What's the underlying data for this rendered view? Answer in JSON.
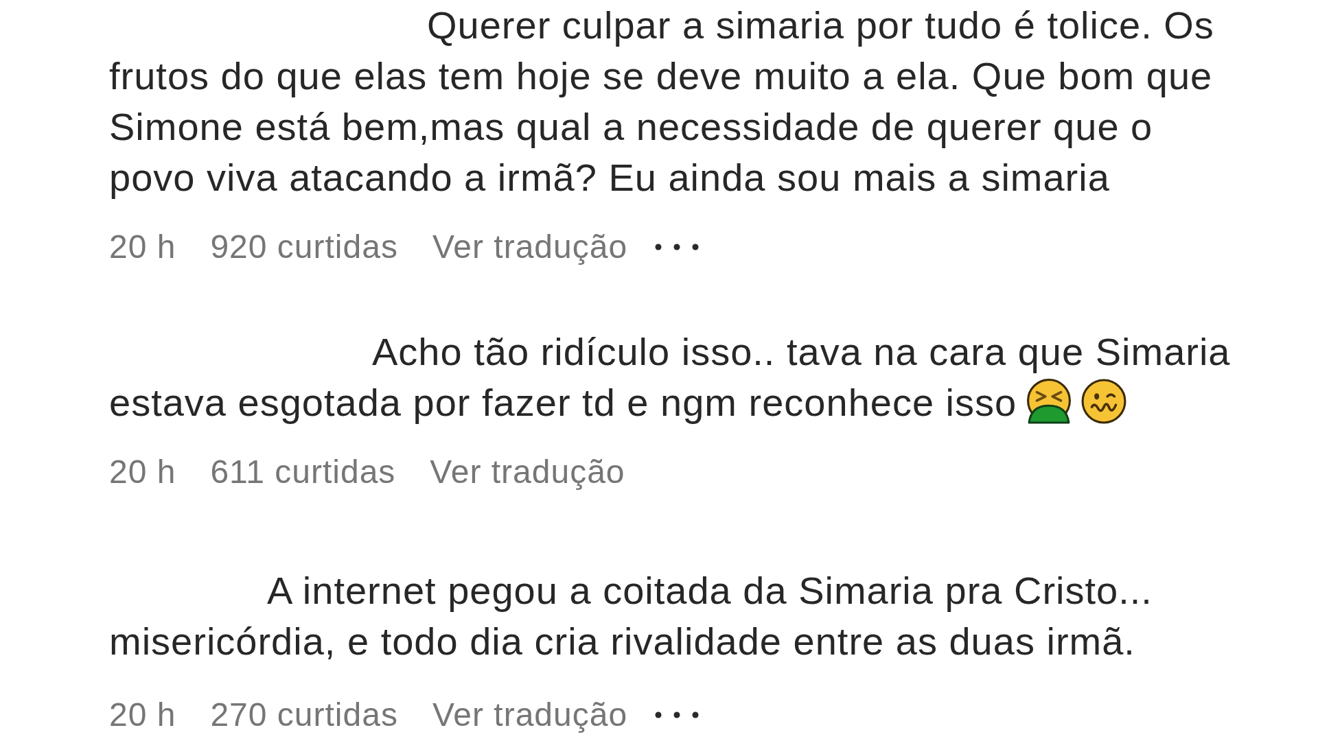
{
  "comments": [
    {
      "text": "Querer culpar a simaria por tudo é tolice. Os frutos do que elas tem hoje se deve muito a ela. Que bom que Simone está bem,mas qual a necessidade de querer que o povo viva atacando a irmã? Eu ainda sou mais a simaria",
      "time": "20 h",
      "likes": "920 curtidas",
      "translate": "Ver tradução",
      "more_menu": true
    },
    {
      "text": "Acho tão ridículo isso.. tava na cara que Simaria estava esgotada por fazer td e ngm reconhece isso",
      "emojis": [
        {
          "kind": "nauseated"
        },
        {
          "kind": "woozy"
        }
      ],
      "time": "20 h",
      "likes": "611 curtidas",
      "translate": "Ver tradução",
      "more_menu": false
    },
    {
      "text": "A internet pegou a coitada da Simaria pra Cristo... misericórdia, e todo dia cria rivalidade entre as duas irmã.",
      "time": "20 h",
      "likes": "270 curtidas",
      "translate": "Ver tradução",
      "more_menu": true
    }
  ]
}
